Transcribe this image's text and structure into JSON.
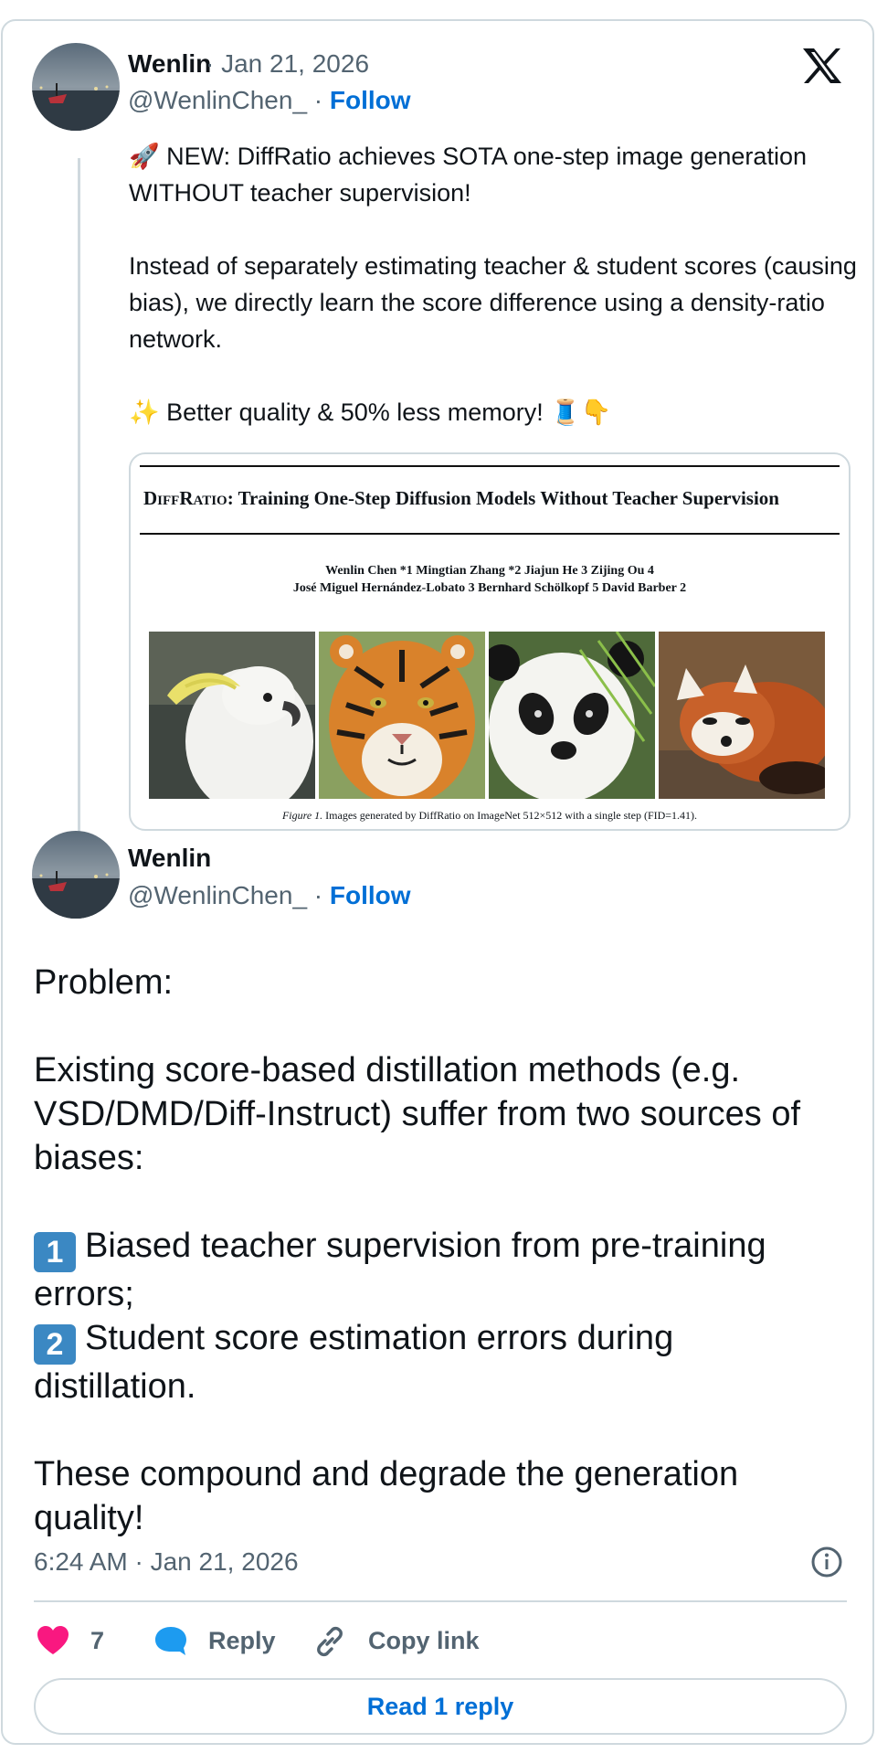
{
  "tweet1": {
    "author_name": "Wenlin",
    "separator": " · ",
    "date": "Jan 21, 2026",
    "handle": "@WenlinChen_",
    "follow_label": "Follow",
    "lines": [
      "🚀 NEW: DiffRatio achieves SOTA one-step image generation WITHOUT teacher supervision!",
      "",
      "Instead of separately estimating teacher & student scores (causing bias), we directly learn the score difference using a density-ratio network.",
      "",
      "✨ Better quality & 50% less memory! 🧵👇"
    ],
    "media": {
      "title_smallcaps": "DiffRatio",
      "title_rest": ": Training One-Step Diffusion Models Without Teacher Supervision",
      "authors_line1": "Wenlin Chen *1   Mingtian Zhang *2   Jiajun He 3   Zijing Ou 4",
      "authors_line2": "José Miguel Hernández-Lobato 3   Bernhard Schölkopf 5   David Barber 2",
      "caption_italic": "Figure 1.",
      "caption_text": " Images generated by DiffRatio on ImageNet 512×512 with a single step (FID=1.41).",
      "photos": [
        "cockatoo",
        "tiger",
        "panda",
        "red-panda"
      ]
    }
  },
  "tweet2": {
    "author_name": "Wenlin",
    "handle": "@WenlinChen_",
    "separator": " · ",
    "follow_label": "Follow",
    "p1": "Problem:",
    "p2": "Existing score-based distillation methods (e.g. VSD/DMD/Diff-Instruct) suffer from two sources of biases:",
    "item1_key": "1",
    "item1_text": "Biased teacher supervision from pre-training errors;",
    "item2_key": "2",
    "item2_text": "Student score estimation errors during distillation.",
    "p4": "These compound and degrade the generation quality!",
    "timestamp": "6:24 AM · Jan 21, 2026"
  },
  "actions": {
    "like_count": "7",
    "reply_label": "Reply",
    "copy_label": "Copy link",
    "read_reply_label": "Read 1 reply"
  },
  "icons": {
    "logo": "x-logo-icon",
    "like": "heart-icon",
    "reply": "speech-bubble-icon",
    "copy": "link-icon",
    "info": "info-icon"
  },
  "colors": {
    "accent": "#1d9bf0",
    "link": "#006fd6",
    "like": "#f91880",
    "border": "#cfd9de",
    "muted": "#536471"
  }
}
